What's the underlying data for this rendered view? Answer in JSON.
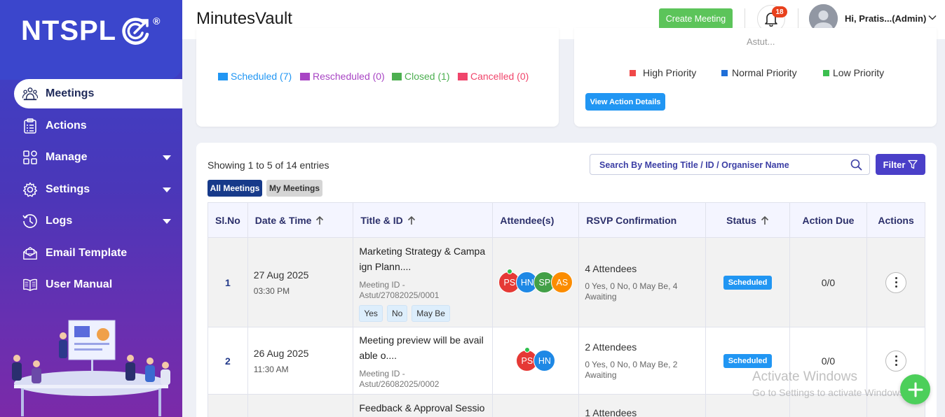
{
  "brand": {
    "name": "NTSPL",
    "reg": "®"
  },
  "sidebar": {
    "items": [
      {
        "label": "Meetings",
        "icon": "meetings-icon",
        "active": true
      },
      {
        "label": "Actions",
        "icon": "clipboard-icon"
      },
      {
        "label": "Manage",
        "icon": "grid-icon",
        "dropdown": true
      },
      {
        "label": "Settings",
        "icon": "gear-icon",
        "dropdown": true
      },
      {
        "label": "Logs",
        "icon": "history-icon",
        "dropdown": true
      },
      {
        "label": "Email Template",
        "icon": "email-icon"
      },
      {
        "label": "User Manual",
        "icon": "book-icon"
      }
    ]
  },
  "header": {
    "title": "MinutesVault",
    "create_label": "Create Meeting",
    "notifications": "18",
    "user": "Hi, Pratis...(Admin)"
  },
  "meeting_card": {
    "legend": [
      {
        "label": "Scheduled (7)",
        "color": "#2196f3"
      },
      {
        "label": "Rescheduled (0)",
        "color": "#a845c4"
      },
      {
        "label": "Closed (1)",
        "color": "#4caf50"
      },
      {
        "label": "Cancelled (0)",
        "color": "#f0456b"
      }
    ]
  },
  "action_card": {
    "faded_text": "Astut...",
    "priorities": [
      {
        "label": "High Priority",
        "color": "#f04848"
      },
      {
        "label": "Normal Priority",
        "color": "#1f6fd8"
      },
      {
        "label": "Low Priority",
        "color": "#3cbf4f"
      }
    ],
    "view_label": "View Action Details"
  },
  "list": {
    "showing": "Showing 1 to 5 of 14 entries",
    "search_placeholder": "Search By Meeting Title / ID / Organiser Name",
    "filter_label": "Filter",
    "tab_all": "All Meetings",
    "tab_my": "My Meetings",
    "columns": [
      "Sl.No",
      "Date & Time",
      "Title & ID",
      "Attendee(s)",
      "RSVP Confirmation",
      "Status",
      "Action Due",
      "Actions"
    ],
    "rows": [
      {
        "sl": "1",
        "date": "27 Aug 2025",
        "time": "03:30 PM",
        "title_l1": "Marketing Strategy & Campa",
        "title_l2": "ign Plann....",
        "id_l1": "Meeting ID -",
        "id_l2": "Astut/27082025/0001",
        "rsvp_yes": "Yes",
        "rsvp_no": "No",
        "rsvp_maybe": "May Be",
        "attendees": [
          {
            "initials": "PS",
            "color": "#e53935"
          },
          {
            "initials": "HN",
            "color": "#1e88e5"
          },
          {
            "initials": "SP",
            "color": "#43a047"
          },
          {
            "initials": "AS",
            "color": "#fb8c00"
          }
        ],
        "rsvp_count": "4 Attendees",
        "rsvp_d1": "0 Yes, 0 No, 0 May Be, 4",
        "rsvp_d2": "Awaiting",
        "status": "Scheduled",
        "due": "0/0"
      },
      {
        "sl": "2",
        "date": "26 Aug 2025",
        "time": "11:30 AM",
        "title_l1": "Meeting preview will be avail",
        "title_l2": "able o....",
        "id_l1": "Meeting ID -",
        "id_l2": "Astut/26082025/0002",
        "attendees": [
          {
            "initials": "PS",
            "color": "#e53935"
          },
          {
            "initials": "HN",
            "color": "#1e88e5"
          }
        ],
        "rsvp_count": "2 Attendees",
        "rsvp_d1": "0 Yes, 0 No, 0 May Be, 2",
        "rsvp_d2": "Awaiting",
        "status": "Scheduled",
        "due": "0/0"
      },
      {
        "title_l1": "Feedback & Approval Sessio",
        "rsvp_count": "1 Attendees"
      }
    ]
  },
  "watermark": {
    "line1": "Activate Windows",
    "line2": "Go to Settings to activate Windows."
  }
}
